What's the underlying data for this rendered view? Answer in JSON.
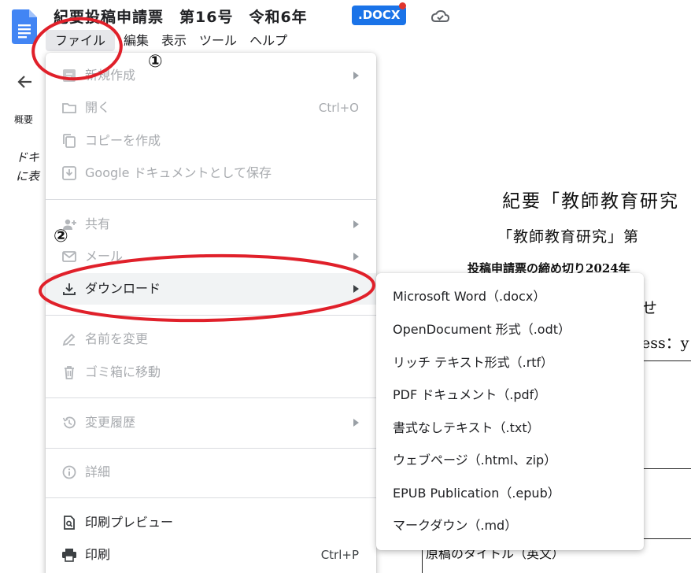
{
  "app": {
    "title": "紀要投稿申請票　第16号　令和6年",
    "format_badge": ".DOCX",
    "accent": "#1a73e8",
    "logo_icon": "docs-logo-icon",
    "cloud_icon": "cloud-status-icon"
  },
  "menubar": [
    {
      "label": "ファイル"
    },
    {
      "label": "編集"
    },
    {
      "label": "表示"
    },
    {
      "label": "ツール"
    },
    {
      "label": "ヘルプ"
    }
  ],
  "side_panel": {
    "outline_label": "概要",
    "hint_text": [
      "ドキ",
      "に表"
    ]
  },
  "file_menu": {
    "items": [
      {
        "label": "新規作成",
        "icon": "new-doc-icon",
        "submenu": true,
        "disabled": true
      },
      {
        "label": "開く",
        "icon": "folder-open-icon",
        "shortcut": "Ctrl+O",
        "disabled": true
      },
      {
        "label": "コピーを作成",
        "icon": "copy-icon",
        "disabled": true
      },
      {
        "label": "Google ドキュメントとして保存",
        "icon": "save-docs-icon",
        "disabled": true
      },
      {
        "label": "共有",
        "icon": "share-person-icon",
        "submenu": true,
        "disabled": true
      },
      {
        "label": "メール",
        "icon": "email-icon",
        "submenu": true,
        "disabled": true
      },
      {
        "label": "ダウンロード",
        "icon": "download-icon",
        "submenu": true,
        "disabled": false
      },
      {
        "label": "名前を変更",
        "icon": "rename-icon",
        "disabled": true
      },
      {
        "label": "ゴミ箱に移動",
        "icon": "trash-icon",
        "disabled": true
      },
      {
        "label": "変更履歴",
        "icon": "history-icon",
        "submenu": true,
        "disabled": true
      },
      {
        "label": "詳細",
        "icon": "info-icon",
        "disabled": true
      },
      {
        "label": "印刷プレビュー",
        "icon": "print-preview-icon",
        "disabled": false
      },
      {
        "label": "印刷",
        "icon": "printer-icon",
        "shortcut": "Ctrl+P",
        "disabled": false
      }
    ]
  },
  "download_submenu": {
    "items": [
      "Microsoft Word（.docx）",
      "OpenDocument 形式（.odt）",
      "リッチ テキスト形式（.rtf）",
      "PDF ドキュメント（.pdf）",
      "書式なしテキスト（.txt）",
      "ウェブページ（.html、zip）",
      "EPUB Publication（.epub）",
      "マークダウン（.md）"
    ]
  },
  "document": {
    "heading": "紀要「教師教育研究",
    "subheading": "「教師教育研究」第",
    "deadline": "投稿申請票の締め切り2024年",
    "line4": "せ　共",
    "address": "ess：y",
    "bottom_text": "原稿のタイトル（英文）"
  },
  "annotations": {
    "step1": "①",
    "step2": "②",
    "color": "#e0202a"
  }
}
